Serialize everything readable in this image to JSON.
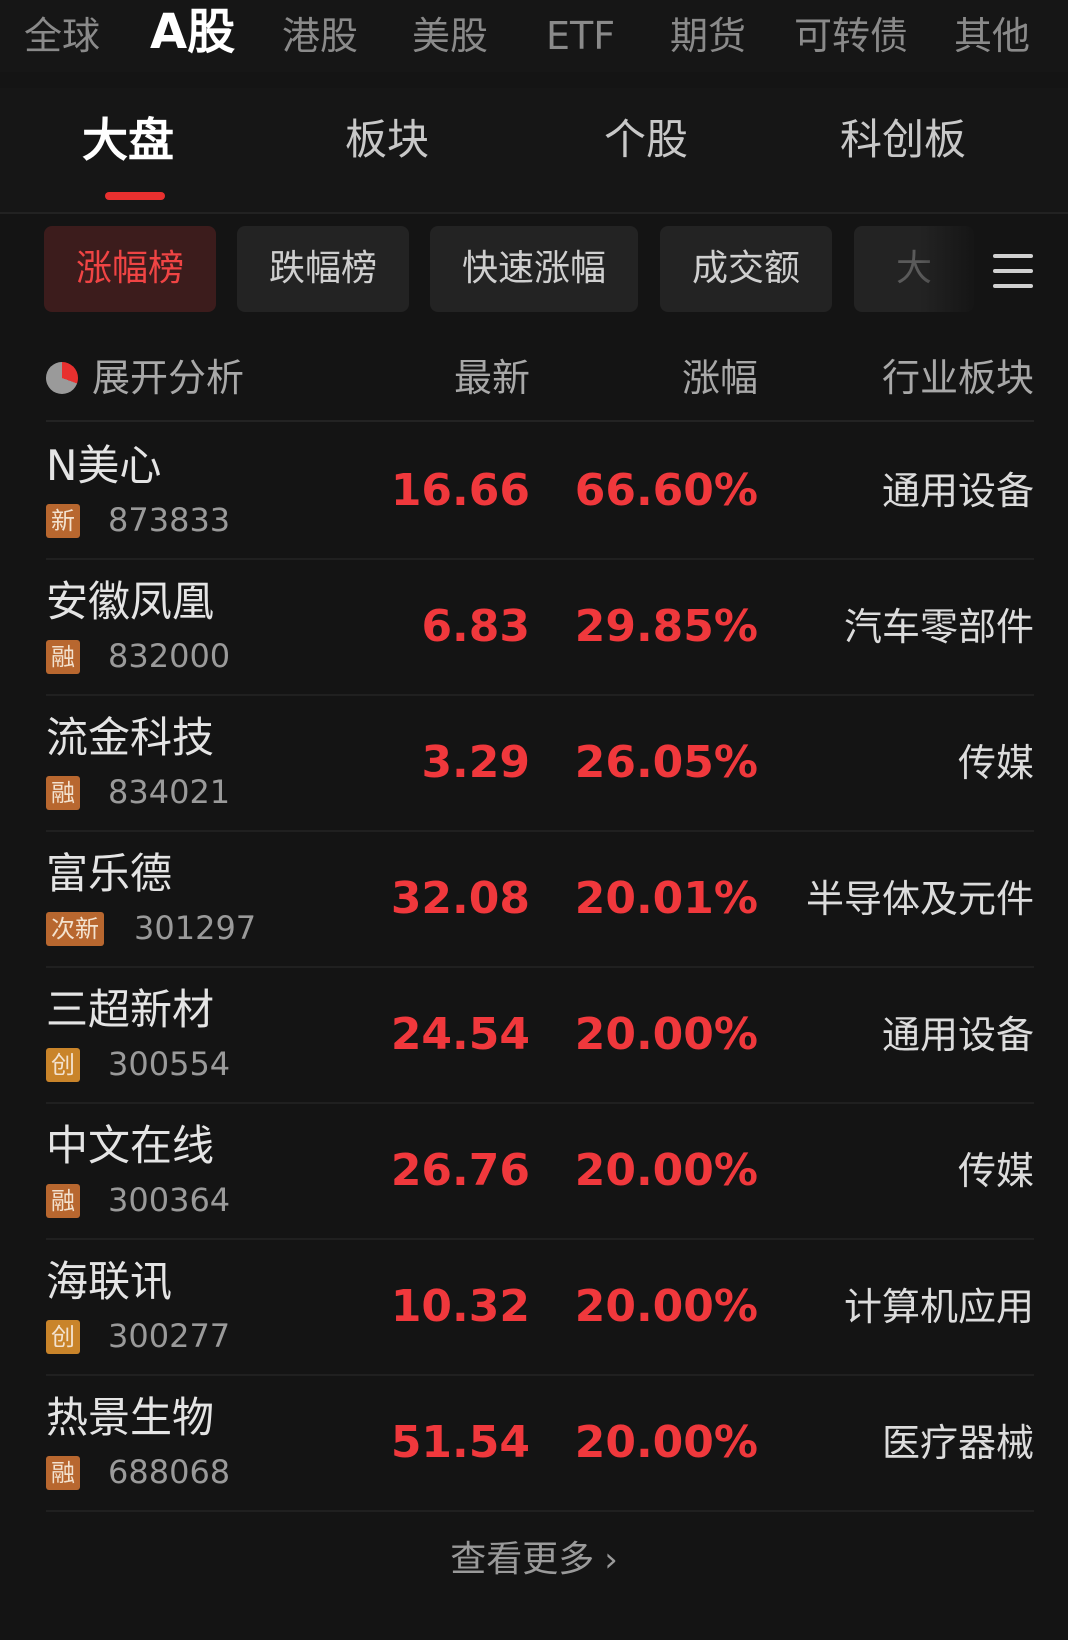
{
  "market_tabs": [
    "全球",
    "A股",
    "港股",
    "美股",
    "ETF",
    "期货",
    "可转债",
    "其他"
  ],
  "market_active": "A股",
  "sub_tabs": [
    "大盘",
    "板块",
    "个股",
    "科创板"
  ],
  "sub_active": "大盘",
  "chips": [
    "涨幅榜",
    "跌幅榜",
    "快速涨幅",
    "成交额",
    "大"
  ],
  "chip_active": "涨幅榜",
  "table_header": {
    "analysis": "展开分析",
    "latest": "最新",
    "change": "涨幅",
    "sector": "行业板块"
  },
  "rows": [
    {
      "name": "N美心",
      "tag": "新",
      "code": "873833",
      "price": "16.66",
      "change": "66.60%",
      "sector": "通用设备"
    },
    {
      "name": "安徽凤凰",
      "tag": "融",
      "code": "832000",
      "price": "6.83",
      "change": "29.85%",
      "sector": "汽车零部件"
    },
    {
      "name": "流金科技",
      "tag": "融",
      "code": "834021",
      "price": "3.29",
      "change": "26.05%",
      "sector": "传媒"
    },
    {
      "name": "富乐德",
      "tag": "次新",
      "code": "301297",
      "price": "32.08",
      "change": "20.01%",
      "sector": "半导体及元件"
    },
    {
      "name": "三超新材",
      "tag": "创",
      "code": "300554",
      "price": "24.54",
      "change": "20.00%",
      "sector": "通用设备"
    },
    {
      "name": "中文在线",
      "tag": "融",
      "code": "300364",
      "price": "26.76",
      "change": "20.00%",
      "sector": "传媒"
    },
    {
      "name": "海联讯",
      "tag": "创",
      "code": "300277",
      "price": "10.32",
      "change": "20.00%",
      "sector": "计算机应用"
    },
    {
      "name": "热景生物",
      "tag": "融",
      "code": "688068",
      "price": "51.54",
      "change": "20.00%",
      "sector": "医疗器械"
    }
  ],
  "more": "查看更多",
  "colors": {
    "up_red": "#f0383c",
    "accent": "#e8302f",
    "tag_orange": "#b8672f",
    "background": "#141414"
  }
}
